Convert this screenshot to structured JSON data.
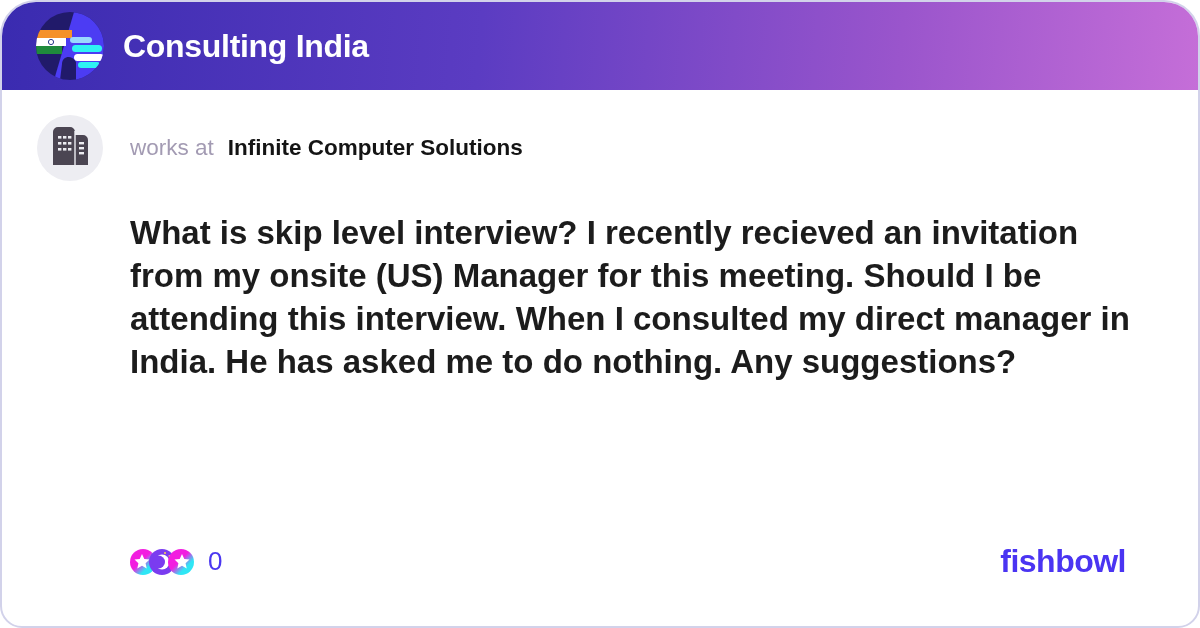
{
  "group": {
    "name": "Consulting India"
  },
  "author": {
    "works_at_label": "works at",
    "company": "Infinite Computer Solutions"
  },
  "post": {
    "text": "What is skip level interview? I recently recieved an invitation from my onsite (US) Manager for this meeting. Should I be attending this interview. When I consulted my direct manager in India. He has asked me to do nothing. Any suggestions?"
  },
  "reactions": {
    "count": "0"
  },
  "brand": {
    "name": "fishbowl"
  }
}
